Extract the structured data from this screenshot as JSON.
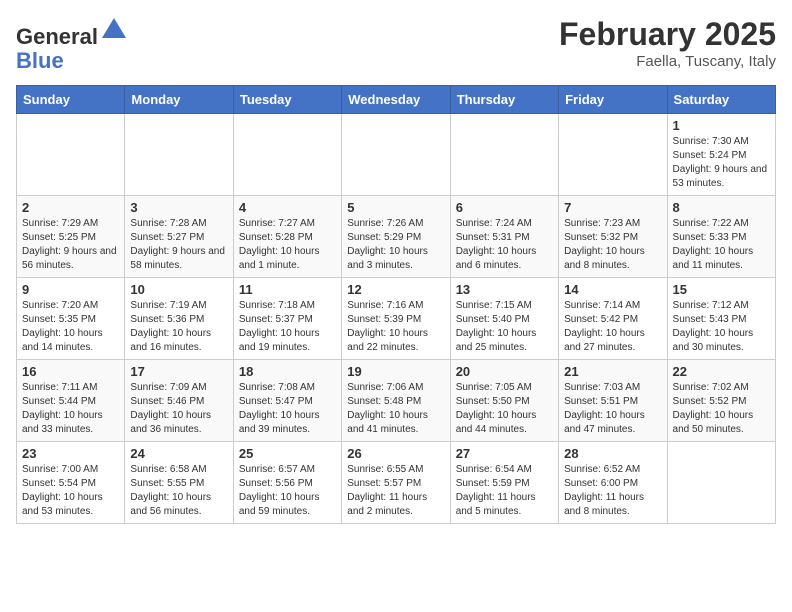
{
  "logo": {
    "general": "General",
    "blue": "Blue"
  },
  "header": {
    "month_year": "February 2025",
    "location": "Faella, Tuscany, Italy"
  },
  "days_of_week": [
    "Sunday",
    "Monday",
    "Tuesday",
    "Wednesday",
    "Thursday",
    "Friday",
    "Saturday"
  ],
  "weeks": [
    [
      {
        "day": "",
        "info": ""
      },
      {
        "day": "",
        "info": ""
      },
      {
        "day": "",
        "info": ""
      },
      {
        "day": "",
        "info": ""
      },
      {
        "day": "",
        "info": ""
      },
      {
        "day": "",
        "info": ""
      },
      {
        "day": "1",
        "info": "Sunrise: 7:30 AM\nSunset: 5:24 PM\nDaylight: 9 hours and 53 minutes."
      }
    ],
    [
      {
        "day": "2",
        "info": "Sunrise: 7:29 AM\nSunset: 5:25 PM\nDaylight: 9 hours and 56 minutes."
      },
      {
        "day": "3",
        "info": "Sunrise: 7:28 AM\nSunset: 5:27 PM\nDaylight: 9 hours and 58 minutes."
      },
      {
        "day": "4",
        "info": "Sunrise: 7:27 AM\nSunset: 5:28 PM\nDaylight: 10 hours and 1 minute."
      },
      {
        "day": "5",
        "info": "Sunrise: 7:26 AM\nSunset: 5:29 PM\nDaylight: 10 hours and 3 minutes."
      },
      {
        "day": "6",
        "info": "Sunrise: 7:24 AM\nSunset: 5:31 PM\nDaylight: 10 hours and 6 minutes."
      },
      {
        "day": "7",
        "info": "Sunrise: 7:23 AM\nSunset: 5:32 PM\nDaylight: 10 hours and 8 minutes."
      },
      {
        "day": "8",
        "info": "Sunrise: 7:22 AM\nSunset: 5:33 PM\nDaylight: 10 hours and 11 minutes."
      }
    ],
    [
      {
        "day": "9",
        "info": "Sunrise: 7:20 AM\nSunset: 5:35 PM\nDaylight: 10 hours and 14 minutes."
      },
      {
        "day": "10",
        "info": "Sunrise: 7:19 AM\nSunset: 5:36 PM\nDaylight: 10 hours and 16 minutes."
      },
      {
        "day": "11",
        "info": "Sunrise: 7:18 AM\nSunset: 5:37 PM\nDaylight: 10 hours and 19 minutes."
      },
      {
        "day": "12",
        "info": "Sunrise: 7:16 AM\nSunset: 5:39 PM\nDaylight: 10 hours and 22 minutes."
      },
      {
        "day": "13",
        "info": "Sunrise: 7:15 AM\nSunset: 5:40 PM\nDaylight: 10 hours and 25 minutes."
      },
      {
        "day": "14",
        "info": "Sunrise: 7:14 AM\nSunset: 5:42 PM\nDaylight: 10 hours and 27 minutes."
      },
      {
        "day": "15",
        "info": "Sunrise: 7:12 AM\nSunset: 5:43 PM\nDaylight: 10 hours and 30 minutes."
      }
    ],
    [
      {
        "day": "16",
        "info": "Sunrise: 7:11 AM\nSunset: 5:44 PM\nDaylight: 10 hours and 33 minutes."
      },
      {
        "day": "17",
        "info": "Sunrise: 7:09 AM\nSunset: 5:46 PM\nDaylight: 10 hours and 36 minutes."
      },
      {
        "day": "18",
        "info": "Sunrise: 7:08 AM\nSunset: 5:47 PM\nDaylight: 10 hours and 39 minutes."
      },
      {
        "day": "19",
        "info": "Sunrise: 7:06 AM\nSunset: 5:48 PM\nDaylight: 10 hours and 41 minutes."
      },
      {
        "day": "20",
        "info": "Sunrise: 7:05 AM\nSunset: 5:50 PM\nDaylight: 10 hours and 44 minutes."
      },
      {
        "day": "21",
        "info": "Sunrise: 7:03 AM\nSunset: 5:51 PM\nDaylight: 10 hours and 47 minutes."
      },
      {
        "day": "22",
        "info": "Sunrise: 7:02 AM\nSunset: 5:52 PM\nDaylight: 10 hours and 50 minutes."
      }
    ],
    [
      {
        "day": "23",
        "info": "Sunrise: 7:00 AM\nSunset: 5:54 PM\nDaylight: 10 hours and 53 minutes."
      },
      {
        "day": "24",
        "info": "Sunrise: 6:58 AM\nSunset: 5:55 PM\nDaylight: 10 hours and 56 minutes."
      },
      {
        "day": "25",
        "info": "Sunrise: 6:57 AM\nSunset: 5:56 PM\nDaylight: 10 hours and 59 minutes."
      },
      {
        "day": "26",
        "info": "Sunrise: 6:55 AM\nSunset: 5:57 PM\nDaylight: 11 hours and 2 minutes."
      },
      {
        "day": "27",
        "info": "Sunrise: 6:54 AM\nSunset: 5:59 PM\nDaylight: 11 hours and 5 minutes."
      },
      {
        "day": "28",
        "info": "Sunrise: 6:52 AM\nSunset: 6:00 PM\nDaylight: 11 hours and 8 minutes."
      },
      {
        "day": "",
        "info": ""
      }
    ]
  ]
}
